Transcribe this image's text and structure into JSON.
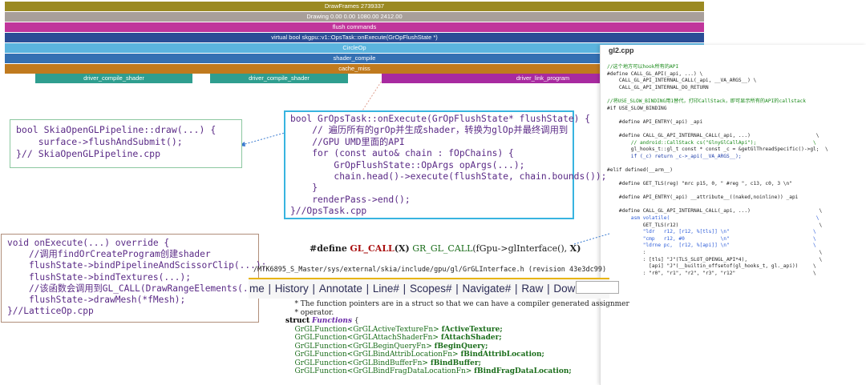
{
  "trace": {
    "rows": [
      {
        "label": "DrawFrames 2739337",
        "color": "#9b8a22"
      },
      {
        "label": "Drawing  0.00  0.00 1080.00 2412.00",
        "color": "#a89f9a"
      },
      {
        "label": "flush commands",
        "color": "#c0359b"
      },
      {
        "label": "virtual bool skgpu::v1::OpsTask::onExecute(GrOpFlushState *)",
        "color": "#2b4d96"
      },
      {
        "label": "CircleOp",
        "color": "#5bb4de"
      },
      {
        "label": "shader_compile",
        "color": "#3470b2"
      },
      {
        "label": "cache_miss",
        "color": "#c07a1e"
      }
    ],
    "driver_row": [
      {
        "label": "driver_compile_shader",
        "color": "#2f9e8f"
      },
      {
        "label": "driver_compile_shader",
        "color": "#2f9e8f"
      },
      {
        "label": "driver_link_program",
        "color": "#a82aa0"
      }
    ]
  },
  "skia_box": {
    "lines": [
      "bool SkiaOpenGLPipeline::draw(...) {",
      "    surface->flushAndSubmit();",
      "}// SkiaOpenGLPipeline.cpp"
    ]
  },
  "opstask_box": {
    "lines": [
      "bool GrOpsTask::onExecute(GrOpFlushState* flushState) {",
      "    // 遍历所有的grOp并生成shader，转换为glOp并最终调用到",
      "    //GPU UMD里面的API",
      "    for (const auto& chain : fOpChains) {",
      "        GrOpFlushState::OpArgs opArgs(...);",
      "        chain.head()->execute(flushState, chain.bounds());",
      "    }",
      "    renderPass->end();",
      "}//OpsTask.cpp"
    ]
  },
  "lattice_box": {
    "lines": [
      "void onExecute(...) override {",
      "    //调用findOrCreateProgram创建shader",
      "    flushState->bindPipelineAndScissorClip(...);",
      "    flushState->bindTextures(...);",
      "    //该函数会调用到GL_CALL(DrawRangeElements(...)",
      "    flushState->drawMesh(*fMesh);",
      "}//LatticeOp.cpp"
    ]
  },
  "define_line": {
    "directive": "#define",
    "macro": "GL_CALL",
    "param1": "(X)",
    "call": "GR_GL_CALL",
    "args": "(fGpu->glInterface(),",
    "param2": "X)"
  },
  "svn_path": "/MTK6895_S_Master/sys/external/skia/include/gpu/gl/GrGLInterface.h (revision 43e3dc99)",
  "nav": {
    "items": [
      "me",
      "History",
      "Annotate",
      "Line#",
      "Scopes#",
      "Navigate#",
      "Raw",
      "Download"
    ]
  },
  "source": {
    "comment1": "    * The function pointers are in a struct so that we can have a compiler generated assignmer",
    "comment2": "    * operator.",
    "struct_kw": "struct",
    "struct_name": "Functions",
    "brace": "{",
    "members": [
      {
        "type": "GrGLFunction<GrGLActiveTextureFn>",
        "name": "fActiveTexture;"
      },
      {
        "type": "GrGLFunction<GrGLAttachShaderFn>",
        "name": "fAttachShader;"
      },
      {
        "type": "GrGLFunction<GrGLBeginQueryFn>",
        "name": "fBeginQuery;"
      },
      {
        "type": "GrGLFunction<GrGLBindAttribLocationFn>",
        "name": "fBindAttribLocation;"
      },
      {
        "type": "GrGLFunction<GrGLBindBufferFn>",
        "name": "fBindBuffer;"
      },
      {
        "type": "GrGLFunction<GrGLBindFragDataLocationFn>",
        "name": "fBindFragDataLocation;"
      }
    ]
  },
  "gl2": {
    "title": "gl2.cpp",
    "lines": [
      {
        "t": "//这个地方可以hook所有的API",
        "c": "c"
      },
      {
        "t": "#define CALL_GL_API(_api, ...) \\",
        "c": ""
      },
      {
        "t": "    CALL_GL_API_INTERNAL_CALL(_api, __VA_ARGS__) \\",
        "c": ""
      },
      {
        "t": "    CALL_GL_API_INTERNAL_DO_RETURN",
        "c": ""
      },
      {
        "t": "",
        "c": ""
      },
      {
        "t": "//将USE_SLOW_BINDING用1替代，打印CallStack，即可显示所有的API的callstack",
        "c": "c"
      },
      {
        "t": "#if USE_SLOW_BINDING",
        "c": ""
      },
      {
        "t": "",
        "c": ""
      },
      {
        "t": "    #define API_ENTRY(_api) _api",
        "c": ""
      },
      {
        "t": "",
        "c": ""
      },
      {
        "t": "    #define CALL_GL_API_INTERNAL_CALL(_api, ...)                      \\",
        "c": ""
      },
      {
        "t": "        // android::CallStack cs(\"GlnyGlCallApi\");                   \\",
        "c": "c"
      },
      {
        "t": "        gl_hooks_t::gl_t const * const _c = &getGlThreadSpecific()->gl;  \\",
        "c": ""
      },
      {
        "t": "        if (_c) return _c->_api(__VA_ARGS__);",
        "c": "b"
      },
      {
        "t": "",
        "c": ""
      },
      {
        "t": "#elif defined(__arm__)",
        "c": ""
      },
      {
        "t": "",
        "c": ""
      },
      {
        "t": "    #define GET_TLS(reg) \"mrc p15, 0, \" #reg \", c13, c0, 3 \\n\"",
        "c": ""
      },
      {
        "t": "",
        "c": ""
      },
      {
        "t": "    #define API_ENTRY(_api) __attribute__((naked,noinline)) _api",
        "c": ""
      },
      {
        "t": "",
        "c": ""
      },
      {
        "t": "    #define CALL_GL_API_INTERNAL_CALL(_api, ...)                       \\",
        "c": ""
      },
      {
        "t": "        asm volatile(                                                 \\",
        "c": "s"
      },
      {
        "t": "            GET_TLS(r12)                                               \\",
        "c": ""
      },
      {
        "t": "            \"ldr   r12, [r12, %[tls]] \\n\"                            \\",
        "c": "s"
      },
      {
        "t": "            \"cmp   r12, #0            \\n\"                            \\",
        "c": "s"
      },
      {
        "t": "            \"ldrne pc,  [r12, %[api]] \\n\"                            \\",
        "c": "s"
      },
      {
        "t": "            :                                                          \\",
        "c": ""
      },
      {
        "t": "            : [tls] \"J\"(TLS_SLOT_OPENGL_API*4),                        \\",
        "c": ""
      },
      {
        "t": "              [api] \"J\"(__builtin_offsetof(gl_hooks_t, gl._api))     \\",
        "c": ""
      },
      {
        "t": "            : \"r0\", \"r1\", \"r2\", \"r3\", \"r12\"                          \\",
        "c": ""
      }
    ]
  }
}
